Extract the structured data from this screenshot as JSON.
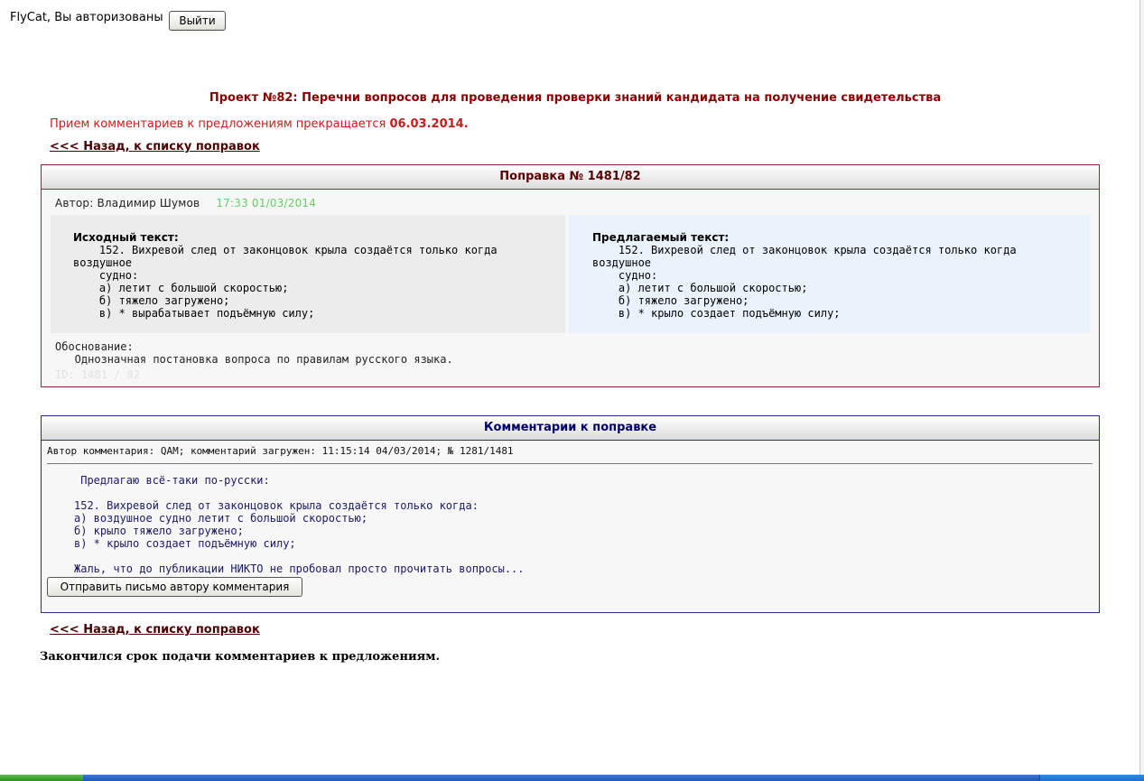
{
  "auth": {
    "user_text": "FlyCat, Вы авторизованы",
    "logout_label": "Выйти"
  },
  "project": {
    "title": "Проект №82: Перечни вопросов для проведения проверки знаний кандидата на получение свидетельства",
    "deadline_prefix": "Прием комментариев к предложениям прекращается ",
    "deadline_date": "06.03.2014."
  },
  "nav": {
    "back_label": "<<<  Назад, к списку поправок"
  },
  "amendment": {
    "header": "Поправка № 1481/82",
    "author": "Автор: Владимир Шумов",
    "timestamp": "17:33 01/03/2014",
    "original_caption": "Исходный текст:",
    "original_text": "    152. Вихревой след от законцовок крыла создаётся только когда\nвоздушное\n    судно:\n    а) летит с большой скоростью;\n    б) тяжело загружено;\n    в) * вырабатывает подъёмную силу;",
    "proposed_caption": "Предлагаемый текст:",
    "proposed_text": "    152. Вихревой след от законцовок крыла создаётся только когда\nвоздушное\n    судно:\n    а) летит с большой скоростью;\n    б) тяжело загружено;\n    в) * крыло создает подъёмную силу;",
    "justification_label": "Обоснование:",
    "justification_text": "   Однозначная постановка вопроса по правилам русского языка.",
    "id_text": "ID: 1481 / 82"
  },
  "comments": {
    "header": "Комментарии к поправке",
    "meta": "Автор комментария: QAM; комментарий загружен: 11:15:14 04/03/2014;  № 1281/1481",
    "body": " Предлагаю всё-таки по-русски:\n\n152. Вихревой след от законцовок крыла создаётся только когда:\nа) воздушное судно летит с большой скоростью;\nб) крыло тяжело загружено;\nв) * крыло создает подъёмную силу;\n\nЖаль, что до публикации НИКТО не пробовал просто прочитать вопросы...",
    "send_label": "Отправить письмо автору комментария"
  },
  "footer": {
    "closed_text": "Закончился срок подачи комментариев к предложениям."
  }
}
